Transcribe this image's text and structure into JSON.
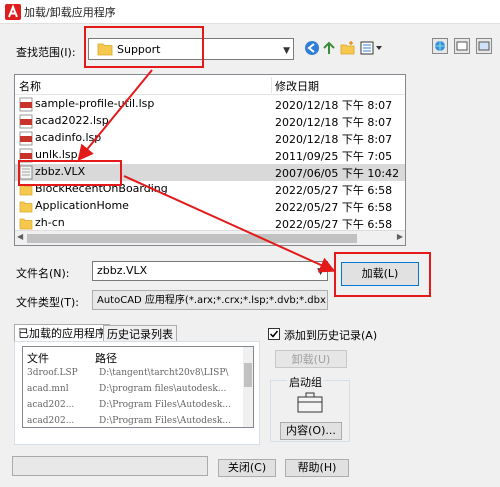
{
  "window": {
    "title": "加载/卸载应用程序"
  },
  "lookin": {
    "label": "查找范围(I):",
    "value": "Support"
  },
  "file_list": {
    "headers": {
      "name": "名称",
      "date": "修改日期"
    },
    "rows": [
      {
        "name": "sample-profile-util.lsp",
        "date": "2020/12/18 下午 8:07",
        "type": "lsp"
      },
      {
        "name": "acad2022.lsp",
        "date": "2020/12/18 下午 8:07",
        "type": "lsp"
      },
      {
        "name": "acadinfo.lsp",
        "date": "2020/12/18 下午 8:07",
        "type": "lsp"
      },
      {
        "name": "unlk.lsp",
        "date": "2011/09/25 下午 7:05",
        "type": "lsp"
      },
      {
        "name": "zbbz.VLX",
        "date": "2007/06/05 下午 10:42",
        "type": "vlx",
        "selected": true
      },
      {
        "name": "BlockRecentOnBoarding",
        "date": "2022/05/27 下午 6:58",
        "type": "folder"
      },
      {
        "name": "ApplicationHome",
        "date": "2022/05/27 下午 6:58",
        "type": "folder"
      },
      {
        "name": "zh-cn",
        "date": "2022/05/27 下午 6:58",
        "type": "folder"
      }
    ]
  },
  "filename": {
    "label": "文件名(N):",
    "value": "zbbz.VLX"
  },
  "filetype": {
    "label": "文件类型(T):",
    "value": "AutoCAD 应用程序(*.arx;*.crx;*.lsp;*.dvb;*.dbx"
  },
  "load_button": "加载(L)",
  "tabs": [
    {
      "label": "已加载的应用程序",
      "active": true
    },
    {
      "label": "历史记录列表",
      "active": false
    }
  ],
  "loaded_list": {
    "headers": {
      "file": "文件",
      "path": "路径"
    },
    "rows": [
      {
        "file": "3droof.LSP",
        "path": "D:\\tangent\\tarcht20v8\\LISP\\"
      },
      {
        "file": "acad.mnl",
        "path": "D:\\program files\\autodesk..."
      },
      {
        "file": "acad202...",
        "path": "D:\\Program Files\\Autodesk..."
      },
      {
        "file": "acad202...",
        "path": "D:\\Program Files\\Autodesk..."
      }
    ]
  },
  "add_history": {
    "label": "添加到历史记录(A)",
    "checked": true
  },
  "unload_button": "卸载(U)",
  "startup_suite": {
    "label": "启动组",
    "contents_button": "内容(O)..."
  },
  "close_button": "关闭(C)",
  "help_button": "帮助(H)",
  "colors": {
    "annotation_red": "#e41a1a",
    "folder_yellow": "#f6c94e",
    "lsp_red": "#c8332c"
  }
}
